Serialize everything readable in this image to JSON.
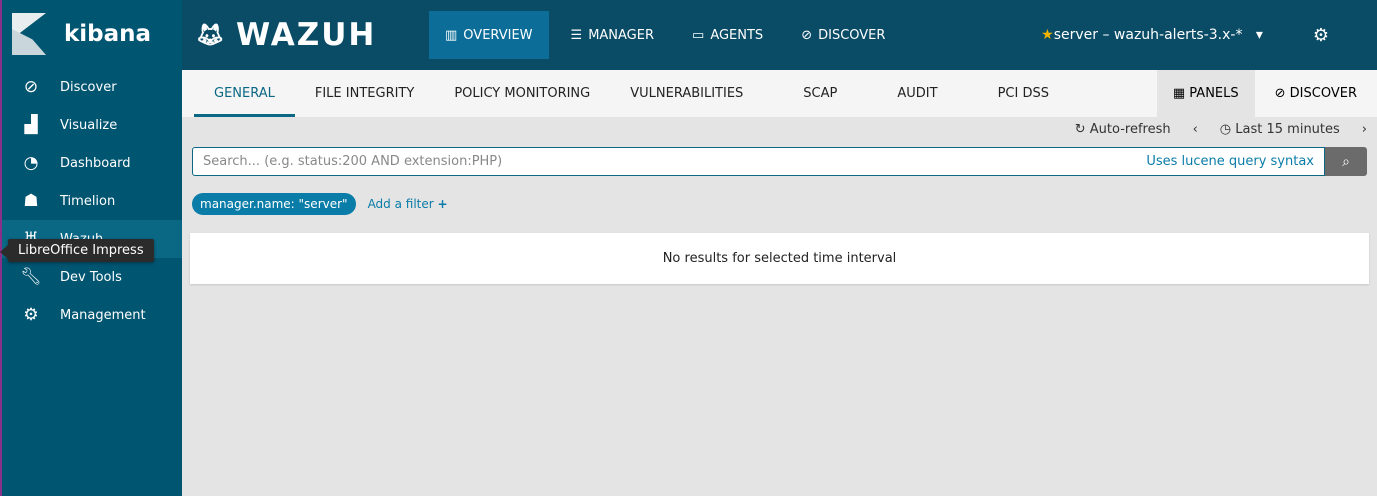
{
  "sidebar": {
    "brand": "kibana",
    "items": [
      {
        "label": "Discover",
        "icon": "compass-icon"
      },
      {
        "label": "Visualize",
        "icon": "bar-chart-icon"
      },
      {
        "label": "Dashboard",
        "icon": "dashboard-icon"
      },
      {
        "label": "Timelion",
        "icon": "bear-icon"
      },
      {
        "label": "Wazuh",
        "icon": "wazuh-icon"
      },
      {
        "label": "Dev Tools",
        "icon": "wrench-icon"
      },
      {
        "label": "Management",
        "icon": "gear-icon"
      }
    ]
  },
  "tooltip": "LibreOffice Impress",
  "topbar": {
    "brand": "WAZUH",
    "tabs": [
      "OVERVIEW",
      "MANAGER",
      "AGENTS",
      "DISCOVER"
    ],
    "index": "server – wazuh-alerts-3.x-*"
  },
  "tabs": {
    "items": [
      "GENERAL",
      "FILE INTEGRITY",
      "POLICY MONITORING",
      "VULNERABILITIES",
      "SCAP",
      "AUDIT",
      "PCI DSS"
    ],
    "panels": "PANELS",
    "discover": "DISCOVER"
  },
  "timebar": {
    "auto_refresh": "Auto-refresh",
    "range": "Last 15 minutes"
  },
  "search": {
    "placeholder": "Search... (e.g. status:200 AND extension:PHP)",
    "syntax": "Uses lucene query syntax"
  },
  "filters": {
    "pill": "manager.name: \"server\"",
    "add": "Add a filter"
  },
  "main": {
    "empty": "No results for selected time interval"
  }
}
